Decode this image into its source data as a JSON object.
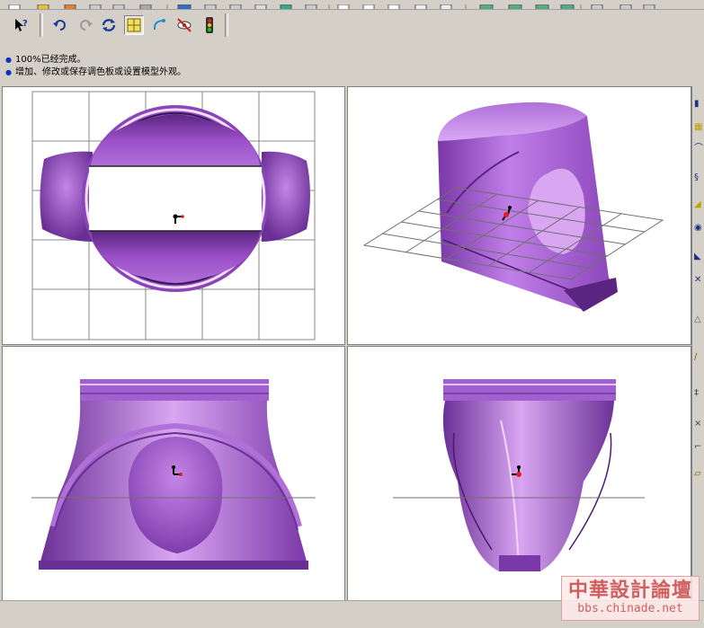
{
  "messages": [
    "100%已经完成。",
    "增加、修改或保存调色板或设置模型外观。"
  ],
  "toolbar": {
    "buttons": [
      "help-pointer",
      "undo",
      "redo",
      "regenerate",
      "grid-display",
      "datum-curve",
      "hide",
      "traffic-light"
    ]
  },
  "watermark": {
    "title": "中華設計論壇",
    "url": "bbs.chinade.net"
  },
  "colors": {
    "model": "#9b4fc9",
    "model_dark": "#6a2f95",
    "model_light": "#d9a6f2",
    "grid": "#808080",
    "watermark": "#d06060"
  },
  "viewports": [
    "top-view",
    "isometric-view",
    "front-view",
    "side-view"
  ]
}
